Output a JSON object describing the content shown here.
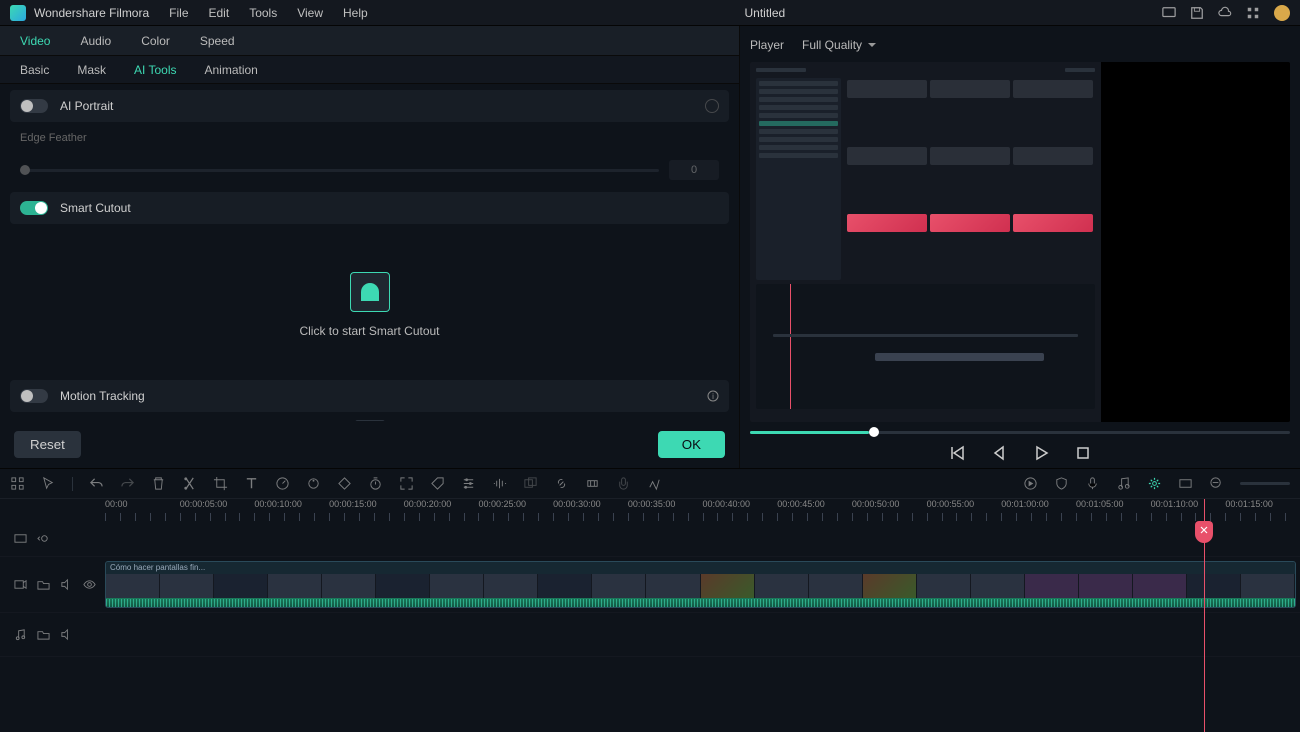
{
  "app": {
    "name": "Wondershare Filmora",
    "menus": [
      "File",
      "Edit",
      "Tools",
      "View",
      "Help"
    ],
    "document_title": "Untitled"
  },
  "panel": {
    "main_tabs": [
      "Video",
      "Audio",
      "Color",
      "Speed"
    ],
    "main_active": 0,
    "sub_tabs": [
      "Basic",
      "Mask",
      "AI Tools",
      "Animation"
    ],
    "sub_active": 2,
    "ai_portrait": {
      "label": "AI Portrait",
      "enabled": false
    },
    "edge_feather": {
      "label": "Edge Feather",
      "value": "0"
    },
    "smart_cutout": {
      "label": "Smart Cutout",
      "enabled": true,
      "cta": "Click to start Smart Cutout"
    },
    "motion_tracking": {
      "label": "Motion Tracking",
      "enabled": false
    },
    "reset_label": "Reset",
    "ok_label": "OK"
  },
  "player": {
    "label": "Player",
    "quality": "Full Quality",
    "progress_pct": 22
  },
  "timeline": {
    "ruler": [
      "00:00",
      "00:00:05:00",
      "00:00:10:00",
      "00:00:15:00",
      "00:00:20:00",
      "00:00:25:00",
      "00:00:30:00",
      "00:00:35:00",
      "00:00:40:00",
      "00:00:45:00",
      "00:00:50:00",
      "00:00:55:00",
      "00:01:00:00",
      "00:01:05:00",
      "00:01:10:00",
      "00:01:15:00"
    ],
    "playhead_pct": 92,
    "clip_title": "Cómo hacer pantallas fin..."
  }
}
